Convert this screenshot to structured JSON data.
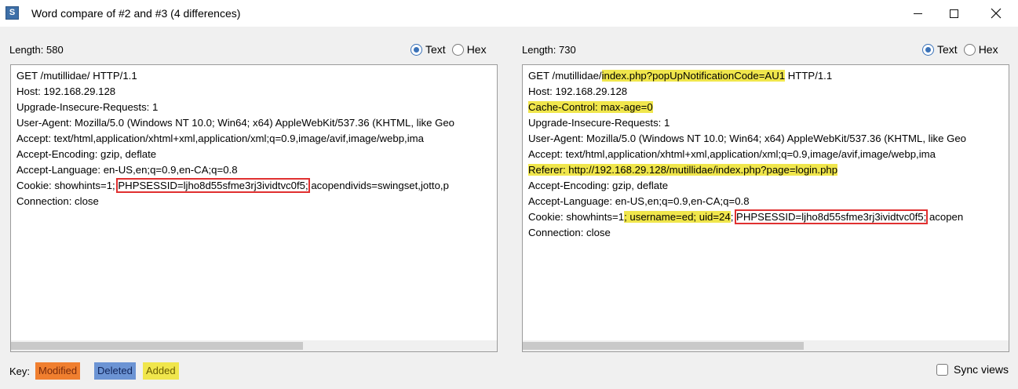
{
  "window": {
    "title": "Word compare of #2 and #3  (4 differences)",
    "app_icon": "S"
  },
  "left_pane": {
    "length_label": "Length: 580",
    "radio_text": "Text",
    "radio_hex": "Hex",
    "selected": "Text",
    "lines": [
      [
        {
          "t": "GET /mutillidae/ HTTP/1.1"
        }
      ],
      [
        {
          "t": "Host: 192.168.29.128"
        }
      ],
      [
        {
          "t": "Upgrade-Insecure-Requests: 1"
        }
      ],
      [
        {
          "t": "User-Agent: Mozilla/5.0 (Windows NT 10.0; Win64; x64) AppleWebKit/537.36 (KHTML, like Geo"
        }
      ],
      [
        {
          "t": "Accept: text/html,application/xhtml+xml,application/xml;q=0.9,image/avif,image/webp,ima"
        }
      ],
      [
        {
          "t": "Accept-Encoding: gzip, deflate"
        }
      ],
      [
        {
          "t": "Accept-Language: en-US,en;q=0.9,en-CA;q=0.8"
        }
      ],
      [
        {
          "t": "Cookie: showhints=1; "
        },
        {
          "t": "PHPSESSID=ljho8d55sfme3rj3ividtvc0f5;",
          "box": true
        },
        {
          "t": " acopendivids=swingset,jotto,p"
        }
      ],
      [
        {
          "t": "Connection: close"
        }
      ]
    ]
  },
  "right_pane": {
    "length_label": "Length: 730",
    "radio_text": "Text",
    "radio_hex": "Hex",
    "selected": "Text",
    "lines": [
      [
        {
          "t": "GET /mutillidae/"
        },
        {
          "t": "index.php?popUpNotificationCode=AU1",
          "added": true
        },
        {
          "t": " HTTP/1.1"
        }
      ],
      [
        {
          "t": "Host: 192.168.29.128"
        }
      ],
      [
        {
          "t": "Cache-Control: max-age=0",
          "added": true
        }
      ],
      [
        {
          "t": "Upgrade-Insecure-Requests: 1"
        }
      ],
      [
        {
          "t": "User-Agent: Mozilla/5.0 (Windows NT 10.0; Win64; x64) AppleWebKit/537.36 (KHTML, like Geo"
        }
      ],
      [
        {
          "t": "Accept: text/html,application/xhtml+xml,application/xml;q=0.9,image/avif,image/webp,ima"
        }
      ],
      [
        {
          "t": "Referer: http://192.168.29.128/mutillidae/index.php?page=login.php",
          "added": true
        }
      ],
      [
        {
          "t": "Accept-Encoding: gzip, deflate"
        }
      ],
      [
        {
          "t": "Accept-Language: en-US,en;q=0.9,en-CA;q=0.8"
        }
      ],
      [
        {
          "t": "Cookie: showhints=1"
        },
        {
          "t": "; username=ed; uid=24",
          "added": true
        },
        {
          "t": "; "
        },
        {
          "t": "PHPSESSID=ljho8d55sfme3rj3ividtvc0f5;",
          "box": true
        },
        {
          "t": " acopen"
        }
      ],
      [
        {
          "t": "Connection: close"
        }
      ]
    ]
  },
  "footer": {
    "key_label": "Key:",
    "modified": "Modified",
    "deleted": "Deleted",
    "added": "Added",
    "sync_label": "Sync views",
    "sync_checked": false
  },
  "colors": {
    "added": "#f0e64c",
    "modified": "#f07f2f",
    "deleted": "#6c94d4",
    "highlight_box": "#e03030"
  }
}
